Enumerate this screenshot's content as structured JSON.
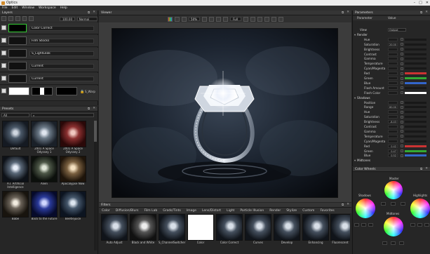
{
  "app": {
    "title": "Optics"
  },
  "menu": [
    "File",
    "Edit",
    "Window",
    "Workspace",
    "Help"
  ],
  "layers": {
    "title": "Layers",
    "opacity": "100.00",
    "blend": "Normal",
    "items": [
      {
        "label": "Color Correct"
      },
      {
        "label": "Film Stocks"
      },
      {
        "label": "S_LightLeak"
      },
      {
        "label": "Current"
      },
      {
        "label": "Current"
      },
      {
        "label": "S_Warp"
      }
    ]
  },
  "presets": {
    "title": "Presets",
    "filter": "All",
    "items": [
      {
        "label": "Default"
      },
      {
        "label": "2001 A Space Odyssey 1"
      },
      {
        "label": "2001 A Space Odyssey 2"
      },
      {
        "label": "A.I. Artificial Intelligence"
      },
      {
        "label": "Alien"
      },
      {
        "label": "Apocalypse Now"
      },
      {
        "label": "Babe"
      },
      {
        "label": "Back to the Future"
      },
      {
        "label": "Beetlejuice"
      }
    ]
  },
  "viewer": {
    "title": "Viewer",
    "zoom": "50%",
    "fit": "Full"
  },
  "filters": {
    "title": "Filters",
    "tabs": [
      "Color",
      "Diffusion/Blurs",
      "Film Lab",
      "Grads/Tints",
      "Image",
      "Lens/Distort",
      "Light",
      "Particle Illusion",
      "Render",
      "Stylize",
      "Custom",
      "Favorites"
    ],
    "items": [
      {
        "label": "Auto Adjust"
      },
      {
        "label": "Black and White"
      },
      {
        "label": "S_ChannelSwitcher"
      },
      {
        "label": "Color"
      },
      {
        "label": "Color Correct"
      },
      {
        "label": "Curves"
      },
      {
        "label": "Develop"
      },
      {
        "label": "Enhancing"
      },
      {
        "label": "Fluorescent"
      }
    ]
  },
  "parameters": {
    "title": "Parameters",
    "col_param": "Parameter",
    "col_value": "Value",
    "view_label": "View",
    "view_value": "Output",
    "rows": [
      {
        "name": "Render",
        "group": true
      },
      {
        "name": "Hue",
        "value": ""
      },
      {
        "name": "Saturation",
        "value": "20.00"
      },
      {
        "name": "Brightness",
        "value": ""
      },
      {
        "name": "Contrast",
        "value": ""
      },
      {
        "name": "Gamma",
        "value": ""
      },
      {
        "name": "Temperature",
        "value": ""
      },
      {
        "name": "Cyan/Magenta",
        "value": ""
      },
      {
        "name": "Red",
        "value": ""
      },
      {
        "name": "Green",
        "value": ""
      },
      {
        "name": "Blue",
        "value": ""
      },
      {
        "name": "Flash Amount",
        "value": ""
      },
      {
        "name": "Flash Color",
        "value": ""
      },
      {
        "name": "Shadows",
        "group": true
      },
      {
        "name": "Position",
        "value": ""
      },
      {
        "name": "Range",
        "value": "80.00"
      },
      {
        "name": "Hue",
        "value": ""
      },
      {
        "name": "Saturation",
        "value": ""
      },
      {
        "name": "Brightness",
        "value": "-8.43"
      },
      {
        "name": "Contrast",
        "value": ""
      },
      {
        "name": "Gamma",
        "value": ""
      },
      {
        "name": "Temperature",
        "value": ""
      },
      {
        "name": "Cyan/Magenta",
        "value": ""
      },
      {
        "name": "Red",
        "value": "0.42"
      },
      {
        "name": "Green",
        "value": "0.47"
      },
      {
        "name": "Blue",
        "value": "0.52"
      },
      {
        "name": "Midtones",
        "group": true
      }
    ]
  },
  "color_wheels": {
    "title": "Color Wheels",
    "labels": [
      "Master",
      "Shadows",
      "Highlights",
      "Midtones"
    ]
  }
}
